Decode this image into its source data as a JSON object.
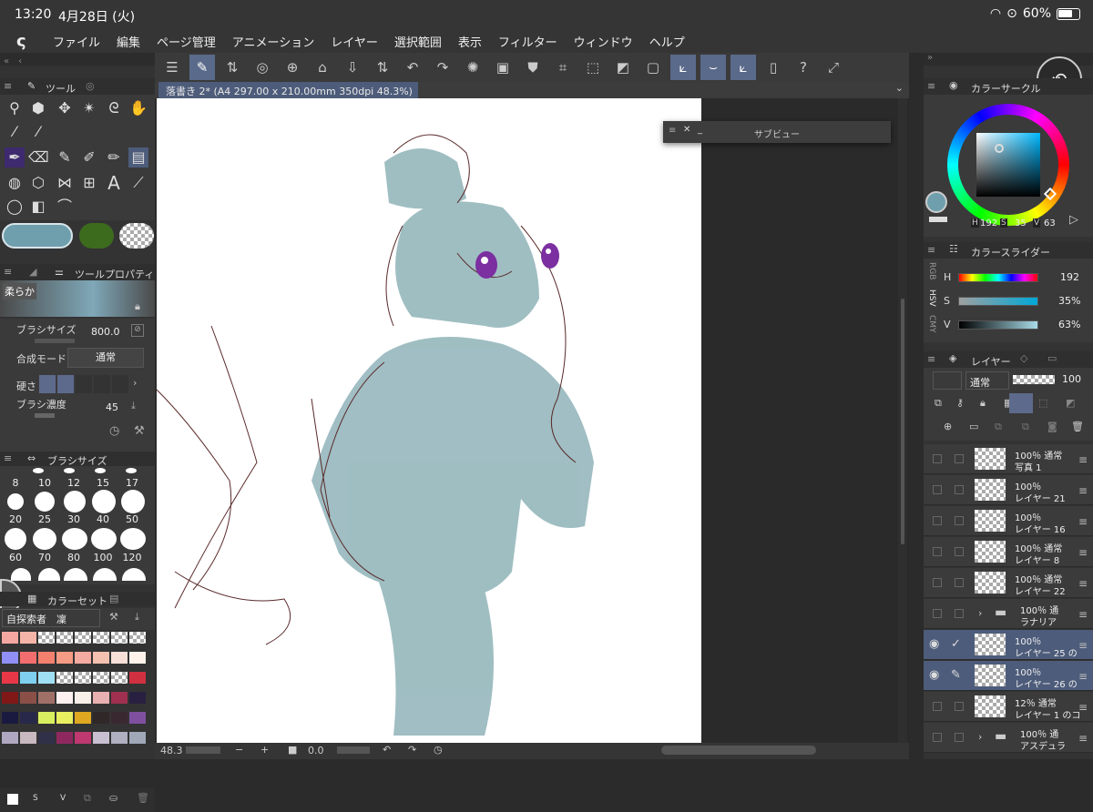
{
  "status": {
    "time": "13:20",
    "date": "4月28日 (火)",
    "battery": "60%"
  },
  "menu": [
    "ファイル",
    "編集",
    "ページ管理",
    "アニメーション",
    "レイヤー",
    "選択範囲",
    "表示",
    "フィルター",
    "ウィンドウ",
    "ヘルプ"
  ],
  "document": {
    "title": "落書き 2* (A4 297.00 x 210.00mm 350dpi 48.3%)"
  },
  "subview": {
    "title": "サブビュー"
  },
  "left": {
    "tool_tab": "ツール",
    "tool_property_tab": "ツールプロパティ",
    "brush_name": "柔らか",
    "props": [
      {
        "label": "ブラシサイズ",
        "value": "800.0"
      },
      {
        "label": "合成モード",
        "value": "通常"
      },
      {
        "label": "硬さ",
        "value": ""
      },
      {
        "label": "ブラシ濃度",
        "value": "45"
      }
    ],
    "brush_size_tab": "ブラシサイズ",
    "brush_sizes_row1": [
      "8",
      "10",
      "12",
      "15",
      "17"
    ],
    "brush_sizes_row2": [
      "20",
      "25",
      "30",
      "40",
      "50"
    ],
    "brush_sizes_row3": [
      "60",
      "70",
      "80",
      "100",
      "120"
    ],
    "color_set_tab": "カラーセット",
    "color_set_name": "自探索者　凜",
    "bottom_icons": [
      "S",
      "V"
    ]
  },
  "bottom": {
    "zoom": "48.3",
    "angle": "0.0"
  },
  "right": {
    "color_circle_tab": "カラーサークル",
    "hsv_readout": {
      "h_label": "H",
      "h": "192",
      "s_label": "S",
      "s": "35",
      "v_label": "V",
      "v": "63"
    },
    "color_slider_tab": "カラースライダー",
    "slider_modes": [
      "RGB",
      "HSV",
      "CMY"
    ],
    "sliders": [
      {
        "label": "H",
        "value": "192"
      },
      {
        "label": "S",
        "value": "35%"
      },
      {
        "label": "V",
        "value": "63%"
      }
    ],
    "layer_tab": "レイヤー",
    "blend_mode": "通常",
    "opacity": "100",
    "layers": [
      {
        "pct": "100％ 通常",
        "name": "写真 1"
      },
      {
        "pct": "100％",
        "name": "レイヤー 21"
      },
      {
        "pct": "100％",
        "name": "レイヤー 16"
      },
      {
        "pct": "100％ 通常",
        "name": "レイヤー 8"
      },
      {
        "pct": "100％ 通常",
        "name": "レイヤー 22"
      },
      {
        "pct": "100％ 通",
        "name": "ラナリア"
      },
      {
        "pct": "100％",
        "name": "レイヤー 25 の"
      },
      {
        "pct": "100％",
        "name": "レイヤー 26 の"
      },
      {
        "pct": "12％ 通常",
        "name": "レイヤー 1 のコ"
      },
      {
        "pct": "100％ 通",
        "name": "アスデュラ"
      }
    ]
  },
  "colors": {
    "accent": "#4d5c7a",
    "current_color": "#6f9fad",
    "secondary_color": "#3d6b1e"
  }
}
